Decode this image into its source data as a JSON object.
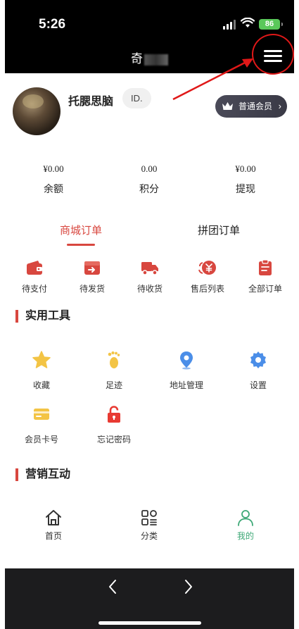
{
  "status_bar": {
    "time": "5:26",
    "battery": "86"
  },
  "nav": {
    "title": "奇",
    "menu_icon": "hamburger-menu-icon"
  },
  "profile": {
    "username": "托腮思脑",
    "id_label": "ID.",
    "member_label": "普通会员"
  },
  "stats": [
    {
      "value": "¥0.00",
      "label": "余额"
    },
    {
      "value": "0.00",
      "label": "积分"
    },
    {
      "value": "¥0.00",
      "label": "提现"
    }
  ],
  "order_tabs": [
    {
      "label": "商城订单",
      "active": true
    },
    {
      "label": "拼团订单",
      "active": false
    }
  ],
  "orders": [
    {
      "label": "待支付",
      "icon": "wallet-icon"
    },
    {
      "label": "待发货",
      "icon": "box-icon"
    },
    {
      "label": "待收货",
      "icon": "truck-icon"
    },
    {
      "label": "售后列表",
      "icon": "refund-icon"
    },
    {
      "label": "全部订单",
      "icon": "clipboard-icon"
    }
  ],
  "tools_section": {
    "title": "实用工具"
  },
  "tools": [
    {
      "label": "收藏",
      "icon": "star-icon"
    },
    {
      "label": "足迹",
      "icon": "footprint-icon"
    },
    {
      "label": "地址管理",
      "icon": "location-pin-icon"
    },
    {
      "label": "设置",
      "icon": "gear-icon"
    },
    {
      "label": "会员卡号",
      "icon": "card-icon"
    },
    {
      "label": "忘记密码",
      "icon": "lock-icon"
    }
  ],
  "marketing_section": {
    "title": "营销互动"
  },
  "tabbar": [
    {
      "label": "首页",
      "icon": "home-icon",
      "active": false
    },
    {
      "label": "分类",
      "icon": "category-icon",
      "active": false
    },
    {
      "label": "我的",
      "icon": "user-icon",
      "active": true
    }
  ],
  "colors": {
    "accent": "#d8473f",
    "active_tab": "#3da876",
    "tool_yellow": "#f3c445",
    "tool_blue": "#4b8ee8",
    "annotation": "#e01818"
  }
}
